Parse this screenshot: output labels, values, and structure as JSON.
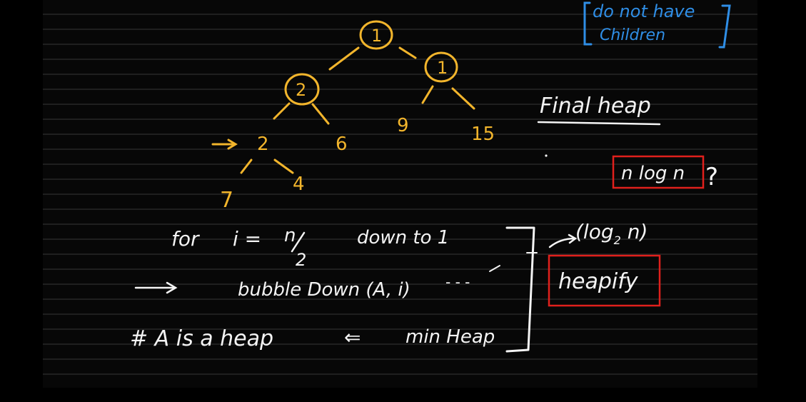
{
  "colors": {
    "background": "#070707",
    "tree_ink": "#f2b52c",
    "text_ink": "#f4f4f4",
    "note_ink": "#2f8ee6",
    "highlight_box": "#e0201c"
  },
  "top_note": {
    "line1": "do not have",
    "line2": "Children"
  },
  "tree_nodes": {
    "root": "1",
    "left": "2",
    "right": "1",
    "left_left": "2",
    "left_right": "6",
    "right_left": "9",
    "right_right": "15",
    "leaf_left": "7",
    "leaf_right": "4"
  },
  "arrow_glyph": "→",
  "final_heap_label": "Final heap",
  "boxed_n_log_n": "n log n",
  "question_mark": "?",
  "log_label": "(log",
  "log_sub": "2",
  "log_tail": " n)",
  "heapify_label": "heapify",
  "code": {
    "line1_for": "for",
    "line1_i": "i =",
    "line1_n": "n",
    "line1_two": "2",
    "line1_rest": "down to 1",
    "line2": "bubble Down (A, i)",
    "line2_dash": "- - -",
    "line3_a": "# A is a heap",
    "line3_arrow": "⇐",
    "line3_b": "min Heap"
  }
}
